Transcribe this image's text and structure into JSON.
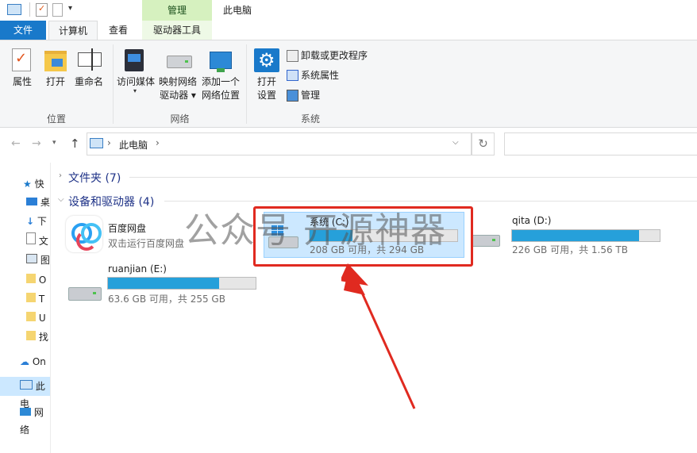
{
  "titlebar": {
    "context_tab": "管理",
    "window_title": "此电脑"
  },
  "tabs": [
    "文件",
    "计算机",
    "查看",
    "驱动器工具"
  ],
  "ribbon": {
    "location": {
      "label": "位置",
      "buttons": [
        "属性",
        "打开",
        "重命名"
      ]
    },
    "network": {
      "label": "网络",
      "media": "访问媒体",
      "map_line1": "映射网络",
      "map_line2": "驱动器",
      "add_line1": "添加一个",
      "add_line2": "网络位置"
    },
    "system": {
      "label": "系统",
      "open_line1": "打开",
      "open_line2": "设置",
      "uninstall": "卸载或更改程序",
      "properties": "系统属性",
      "manage": "管理"
    }
  },
  "address": {
    "path": "此电脑"
  },
  "nav": [
    "快",
    "桌",
    "下",
    "文",
    "图",
    "O",
    "T",
    "U",
    "找",
    "On",
    "此电",
    "网络"
  ],
  "sections": {
    "folders": "文件夹 (7)",
    "devices": "设备和驱动器 (4)"
  },
  "devices": [
    {
      "name": "百度网盘",
      "sub": "双击运行百度网盘"
    },
    {
      "name": "系统 (C:)",
      "sub": "208 GB 可用，共 294 GB",
      "used_fraction": 0.29
    },
    {
      "name": "qita (D:)",
      "sub": "226 GB 可用，共 1.56 TB",
      "used_fraction": 0.86
    },
    {
      "name": "ruanjian (E:)",
      "sub": "63.6 GB 可用，共 255 GB",
      "used_fraction": 0.75
    }
  ],
  "watermark": "公众号 开源神器",
  "colors": {
    "accent": "#1979ca",
    "drive_bar": "#26a0da",
    "highlight": "#cce8ff",
    "annotation": "#e02a20"
  }
}
